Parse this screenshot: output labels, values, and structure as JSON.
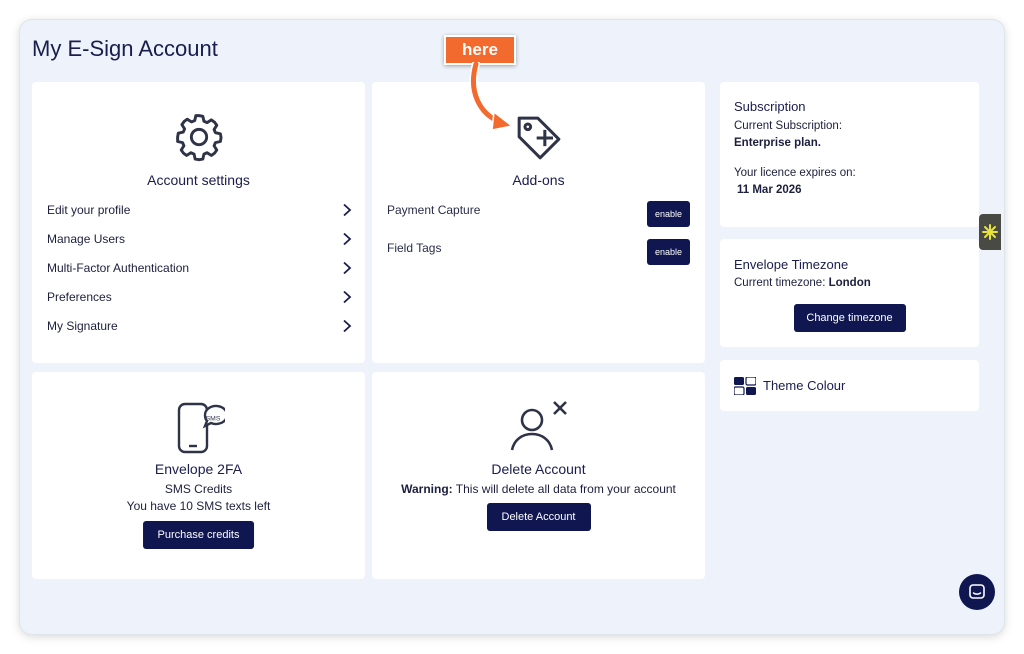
{
  "page": {
    "title": "My E-Sign Account"
  },
  "annotation": {
    "label": "here",
    "color": "#f26a2e"
  },
  "account_settings": {
    "title": "Account settings",
    "icon": "gear-icon",
    "items": [
      {
        "label": "Edit your profile"
      },
      {
        "label": "Manage Users"
      },
      {
        "label": "Multi-Factor Authentication"
      },
      {
        "label": "Preferences"
      },
      {
        "label": "My Signature"
      }
    ]
  },
  "addons": {
    "title": "Add-ons",
    "icon": "tag-plus-icon",
    "items": [
      {
        "label": "Payment Capture",
        "button": "enable"
      },
      {
        "label": "Field Tags",
        "button": "enable"
      }
    ]
  },
  "envelope_2fa": {
    "title": "Envelope 2FA",
    "icon": "phone-sms-icon",
    "icon_text": "SMS",
    "line1": "SMS Credits",
    "line2": "You have 10 SMS texts left",
    "button": "Purchase credits"
  },
  "delete_account": {
    "title": "Delete Account",
    "icon": "user-remove-icon",
    "warning_label": "Warning:",
    "warning_text": " This will delete all data from your account",
    "button": "Delete Account"
  },
  "subscription": {
    "title": "Subscription",
    "current_label": "Current Subscription:",
    "current_value": "Enterprise plan.",
    "expires_label": "Your licence expires on:",
    "expires_value": "11 Mar 2026"
  },
  "timezone": {
    "title": "Envelope Timezone",
    "current_label": "Current timezone:",
    "current_value": "London",
    "button": "Change timezone"
  },
  "theme": {
    "title": "Theme Colour",
    "icon": "theme-palette-icon"
  },
  "colors": {
    "navy": "#0f1650",
    "background": "#eef3fb",
    "accent": "#f26a2e"
  }
}
